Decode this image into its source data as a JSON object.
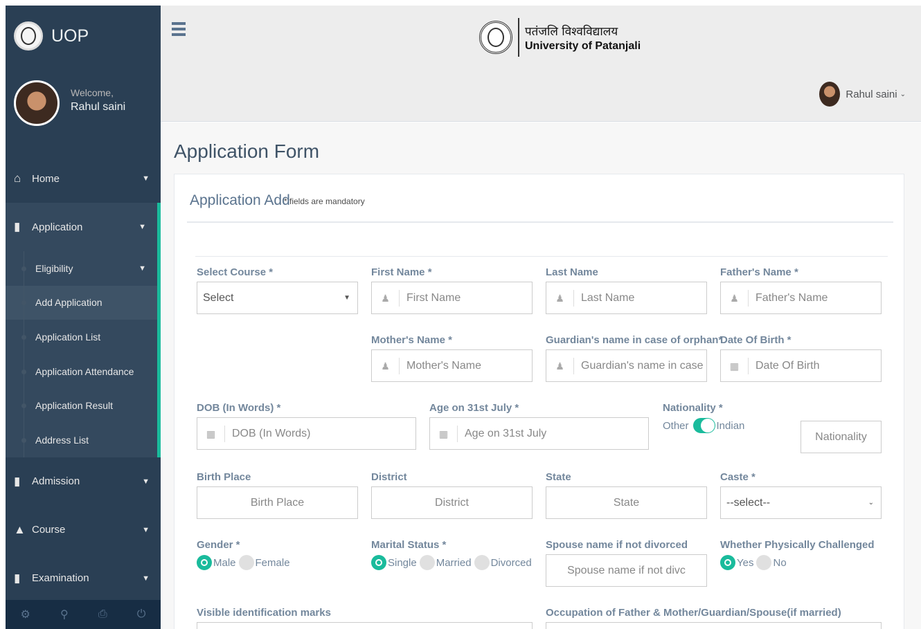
{
  "brand": {
    "name": "UOP"
  },
  "profile": {
    "welcome": "Welcome,",
    "name": "Rahul saini"
  },
  "menu": {
    "home": "Home",
    "application": "Application",
    "submenu": [
      "Eligibility",
      "Add Application",
      "Application List",
      "Application Attendance",
      "Application Result",
      "Address List"
    ],
    "admission": "Admission",
    "course": "Course",
    "examination": "Examination"
  },
  "header": {
    "uni_hindi": "पतंजलि विश्वविद्यालय",
    "uni_english": "University of Patanjali",
    "user": "Rahul saini"
  },
  "page": {
    "title": "Application Form",
    "panel_title": "Application Add",
    "panel_note": "* fields are mandatory"
  },
  "form": {
    "course_label": "Select Course *",
    "course_value": "Select",
    "first_name_label": "First Name *",
    "first_name_ph": "First Name",
    "last_name_label": "Last Name",
    "last_name_ph": "Last Name",
    "father_label": "Father's Name *",
    "father_ph": "Father's Name",
    "mother_label": "Mother's Name *",
    "mother_ph": "Mother's Name",
    "guardian_label": "Guardian's name in case of orphan*",
    "guardian_ph": "Guardian's name in case",
    "dob_label": "Date Of Birth *",
    "dob_ph": "Date Of Birth",
    "dob_words_label": "DOB (In Words) *",
    "dob_words_ph": "DOB (In Words)",
    "age_label": "Age on 31st July *",
    "age_ph": "Age on 31st July",
    "nationality_label": "Nationality *",
    "nationality_other": "Other",
    "nationality_indian": "Indian",
    "nationality_ph": "Nationality",
    "birth_place_label": "Birth Place",
    "birth_place_ph": "Birth Place",
    "district_label": "District",
    "district_ph": "District",
    "state_label": "State",
    "state_ph": "State",
    "caste_label": "Caste *",
    "caste_value": "--select--",
    "gender_label": "Gender *",
    "gender_male": "Male",
    "gender_female": "Female",
    "marital_label": "Marital Status *",
    "marital_single": "Single",
    "marital_married": "Married",
    "marital_divorced": "Divorced",
    "spouse_label": "Spouse name if not divorced",
    "spouse_ph": "Spouse name if not divc",
    "physically_label": "Whether Physically Challenged",
    "physically_yes": "Yes",
    "physically_no": "No",
    "marks_label": "Visible identification marks",
    "occupation_label": "Occupation of Father & Mother/Guardian/Spouse(if married)"
  }
}
